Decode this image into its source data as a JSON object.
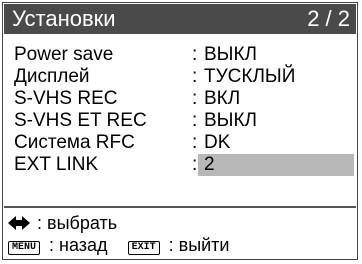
{
  "header": {
    "title": "Установки",
    "page": "2 / 2"
  },
  "settings": [
    {
      "label": "Power save",
      "value": "ВЫКЛ"
    },
    {
      "label": "Дисплей",
      "value": "ТУСКЛЫЙ"
    },
    {
      "label": "S-VHS REC",
      "value": "ВКЛ"
    },
    {
      "label": "S-VHS ET REC",
      "value": "ВЫКЛ"
    },
    {
      "label": "Система RFC",
      "value": "DK"
    },
    {
      "label": "EXT LINK",
      "value": "2"
    }
  ],
  "colon": ":",
  "footer": {
    "select_text": ": выбрать",
    "menu_key": "MENU",
    "back_text": ": назад",
    "exit_key": "EXIT",
    "exit_text": ": выйти"
  },
  "colors": {
    "titlebar": "#4a4a4a",
    "highlight": "#b8b8b8"
  },
  "icons": {
    "select": "left-right-arrow-icon"
  }
}
